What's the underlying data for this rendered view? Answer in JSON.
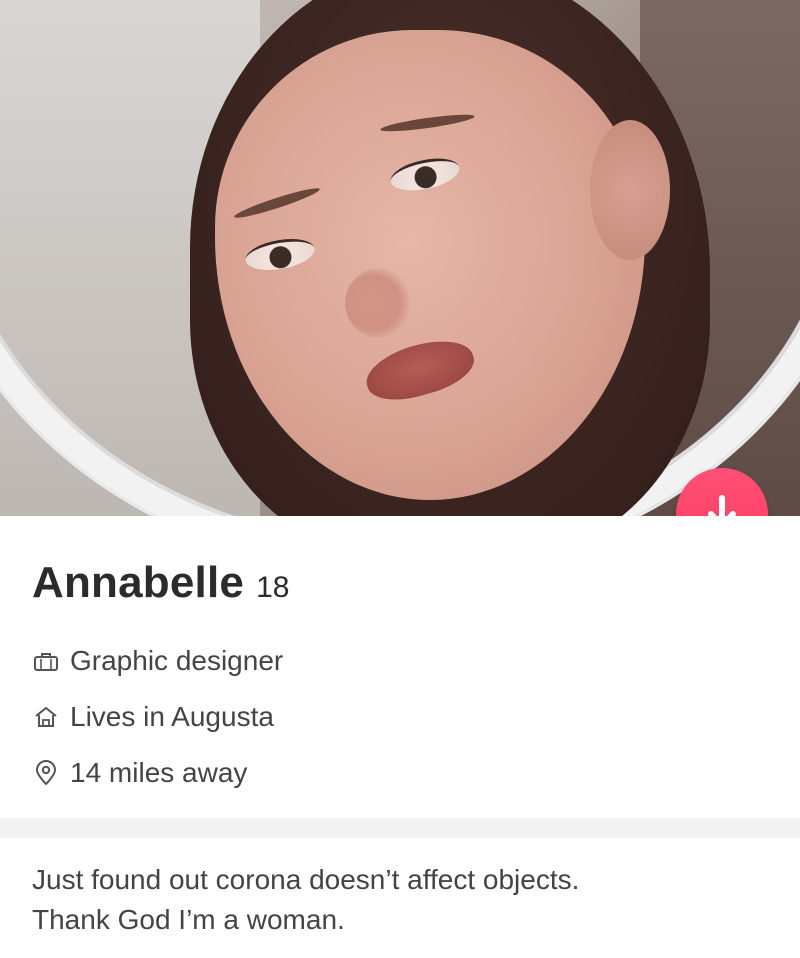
{
  "profile": {
    "name": "Annabelle",
    "age": "18",
    "job": "Graphic designer",
    "lives": "Lives in Augusta",
    "distance": "14 miles away",
    "bio_line1": "Just found out corona doesn’t affect objects.",
    "bio_line2": "Thank God I’m a woman."
  },
  "icons": {
    "job": "briefcase-icon",
    "home": "home-icon",
    "distance": "location-pin-icon",
    "badge": "arrow-down-icon"
  },
  "colors": {
    "badge": "#ff3d5f",
    "name_text": "#2b2b2b",
    "detail_text": "#444444"
  }
}
